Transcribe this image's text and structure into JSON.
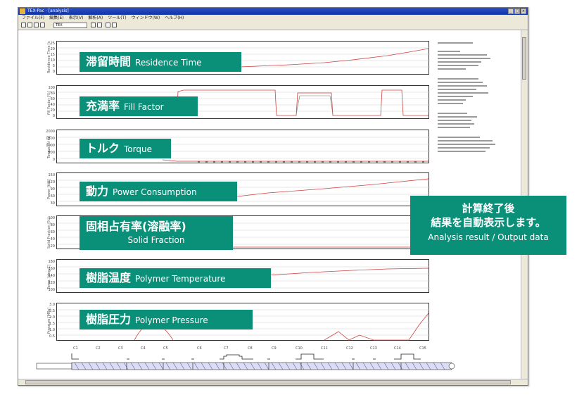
{
  "window": {
    "title": "TEX-Pac - [analysis]",
    "menu": [
      "ファイル(F)",
      "編集(E)",
      "表示(V)",
      "解析(A)",
      "ツール(T)",
      "ウィンドウ(W)",
      "ヘルプ(H)"
    ],
    "toolbar_select": "TEX"
  },
  "panels": [
    {
      "ylabel": "Residence Time [s]",
      "ticks": [
        "25",
        "20",
        "15",
        "10",
        "5",
        "0"
      ],
      "label_jp": "滞留時間",
      "label_en": "Residence Time"
    },
    {
      "ylabel": "Fill Factor [%]",
      "ticks": [
        "100",
        "80",
        "60",
        "40",
        "20",
        "0"
      ],
      "label_jp": "充満率",
      "label_en": "Fill Factor"
    },
    {
      "ylabel": "Torque [N·m]",
      "ticks": [
        "2000",
        "1500",
        "1000",
        "500",
        "0"
      ],
      "label_jp": "トルク",
      "label_en": "Torque"
    },
    {
      "ylabel": "Power [kW]",
      "ticks": [
        "150",
        "120",
        "90",
        "60",
        "30"
      ],
      "label_jp": "動力",
      "label_en": "Power Consumption"
    },
    {
      "ylabel": "Solid Fraction [%]",
      "ticks": [
        "100",
        "80",
        "60",
        "40",
        "20"
      ],
      "label_jp": "固相占有率(溶融率)",
      "label_en": "Solid Fraction"
    },
    {
      "ylabel": "Temp. [deg.C]",
      "ticks": [
        "180",
        "160",
        "140",
        "120",
        "100"
      ],
      "label_jp": "樹脂温度",
      "label_en": "Polymer Temperature"
    },
    {
      "ylabel": "Pressure [MPa]",
      "ticks": [
        "3.0",
        "2.5",
        "2.0",
        "1.5",
        "1.0",
        "0.5"
      ],
      "label_jp": "樹脂圧力",
      "label_en": "Polymer Pressure"
    }
  ],
  "callout": {
    "line1": "計算終了後",
    "line2": "結果を自動表示します。",
    "line3": "Analysis result / Output data"
  },
  "screw_segments": [
    "C1",
    "C2",
    "C3",
    "C4",
    "C5",
    "C6",
    "C7",
    "C8",
    "C9",
    "C10",
    "C11",
    "C12",
    "C13",
    "C14",
    "C15"
  ],
  "colors": {
    "accent": "#0a8f79",
    "trace": "#d04040"
  }
}
